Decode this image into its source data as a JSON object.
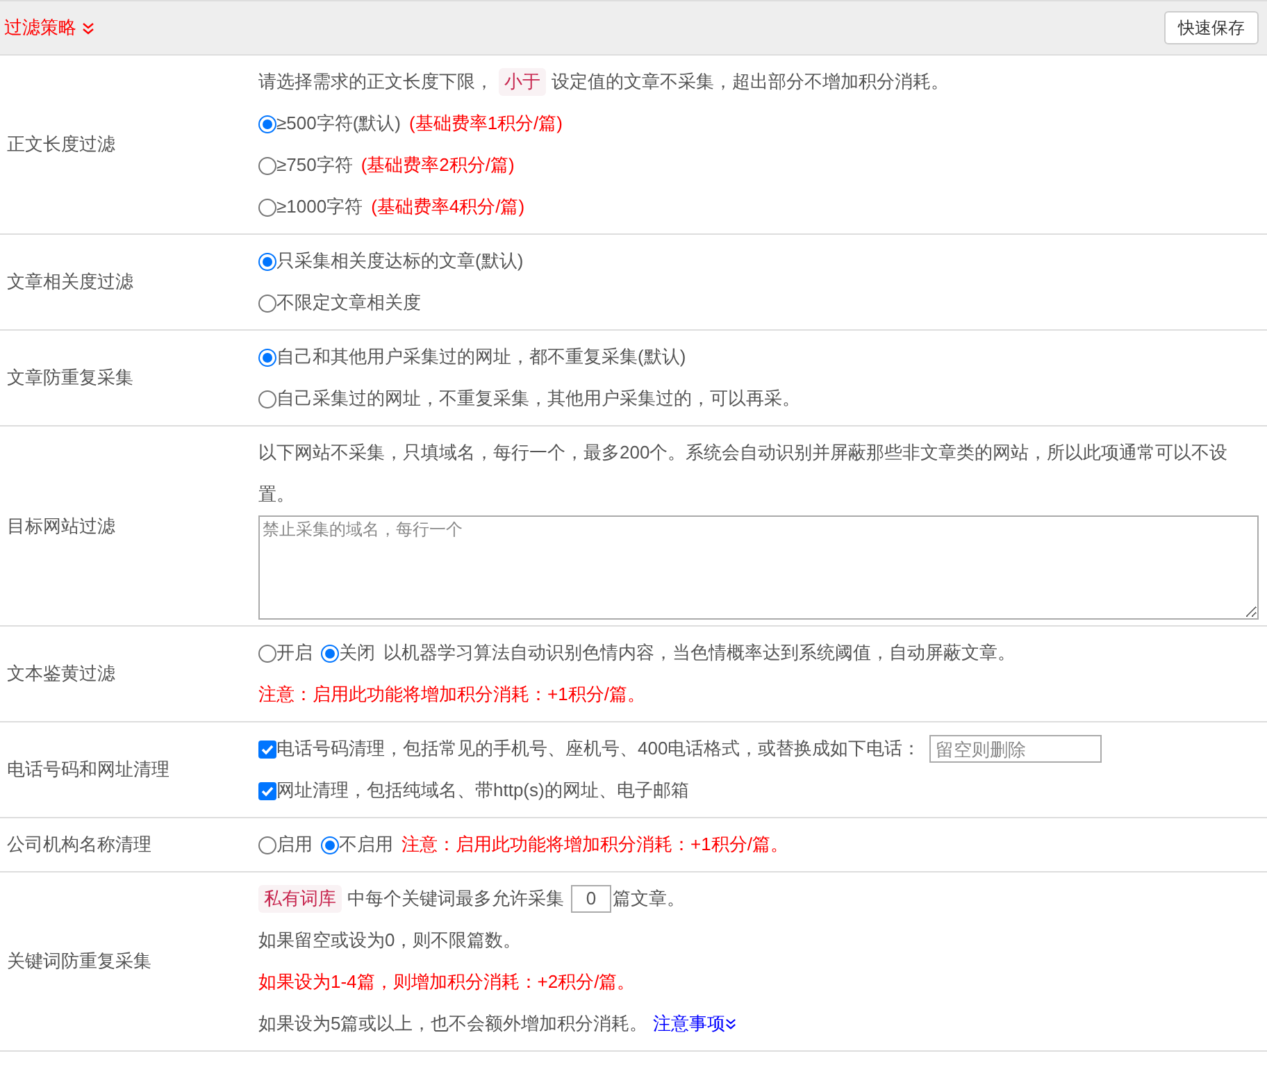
{
  "header": {
    "title": "过滤策略",
    "save_button": "快速保存"
  },
  "rows": [
    {
      "label": "正文长度过滤",
      "lines": [
        [
          {
            "kind": "text",
            "text": "请选择需求的正文长度下限，"
          },
          {
            "kind": "tag",
            "text": "小于"
          },
          {
            "kind": "text",
            "text": "设定值的文章不采集，超出部分不增加积分消耗。"
          }
        ],
        [
          {
            "kind": "radio",
            "label": "≥500字符(默认)",
            "selected": true
          },
          {
            "kind": "warning",
            "text": "(基础费率1积分/篇)"
          }
        ],
        [
          {
            "kind": "radio",
            "label": "≥750字符",
            "selected": false
          },
          {
            "kind": "warning",
            "text": "(基础费率2积分/篇)"
          }
        ],
        [
          {
            "kind": "radio",
            "label": "≥1000字符",
            "selected": false
          },
          {
            "kind": "warning",
            "text": "(基础费率4积分/篇)"
          }
        ]
      ]
    },
    {
      "label": "文章相关度过滤",
      "lines": [
        [
          {
            "kind": "radio",
            "label": "只采集相关度达标的文章(默认)",
            "selected": true
          }
        ],
        [
          {
            "kind": "radio",
            "label": "不限定文章相关度",
            "selected": false
          }
        ]
      ]
    },
    {
      "label": "文章防重复采集",
      "lines": [
        [
          {
            "kind": "radio",
            "label": "自己和其他用户采集过的网址，都不重复采集(默认)",
            "selected": true
          }
        ],
        [
          {
            "kind": "radio",
            "label": "自己采集过的网址，不重复采集，其他用户采集过的，可以再采。",
            "selected": false
          }
        ]
      ]
    },
    {
      "label": "目标网站过滤",
      "lines": [
        [
          {
            "kind": "text",
            "text": "以下网站不采集，只填域名，每行一个，最多200个。系统会自动识别并屏蔽那些非文章类的网站，所以此项通常可以不设置。"
          }
        ],
        [
          {
            "kind": "textarea",
            "placeholder": "禁止采集的域名，每行一个"
          }
        ]
      ]
    },
    {
      "label": "文本鉴黄过滤",
      "lines": [
        [
          {
            "kind": "radio",
            "label": "开启",
            "selected": false
          },
          {
            "kind": "radio",
            "label": "关闭",
            "selected": true
          },
          {
            "kind": "text",
            "text": "以机器学习算法自动识别色情内容，当色情概率达到系统阈值，自动屏蔽文章。"
          }
        ],
        [
          {
            "kind": "warning",
            "text": "注意：启用此功能将增加积分消耗：+1积分/篇。"
          }
        ]
      ]
    },
    {
      "label": "电话号码和网址清理",
      "lines": [
        [
          {
            "kind": "checkbox",
            "label": "电话号码清理，包括常见的手机号、座机号、400电话格式，或替换成如下电话：",
            "checked": true
          },
          {
            "kind": "input",
            "placeholder": "留空则删除"
          }
        ],
        [
          {
            "kind": "checkbox",
            "label": "网址清理，包括纯域名、带http(s)的网址、电子邮箱",
            "checked": true
          }
        ]
      ]
    },
    {
      "label": "公司机构名称清理",
      "lines": [
        [
          {
            "kind": "radio",
            "label": "启用",
            "selected": false
          },
          {
            "kind": "radio",
            "label": "不启用",
            "selected": true
          },
          {
            "kind": "warning",
            "text": "注意：启用此功能将增加积分消耗：+1积分/篇。"
          }
        ]
      ]
    },
    {
      "label": "关键词防重复采集",
      "lines": [
        [
          {
            "kind": "tag",
            "text": "私有词库"
          },
          {
            "kind": "text",
            "text": "中每个关键词最多允许采集"
          },
          {
            "kind": "number",
            "value": "0"
          },
          {
            "kind": "text",
            "text": "篇文章。"
          }
        ],
        [
          {
            "kind": "text",
            "text": "如果留空或设为0，则不限篇数。"
          }
        ],
        [
          {
            "kind": "warning",
            "text": "如果设为1-4篇，则增加积分消耗：+2积分/篇。"
          }
        ],
        [
          {
            "kind": "text",
            "text": "如果设为5篇或以上，也不会额外增加积分消耗。"
          },
          {
            "kind": "link",
            "text": "注意事项"
          }
        ]
      ]
    }
  ]
}
